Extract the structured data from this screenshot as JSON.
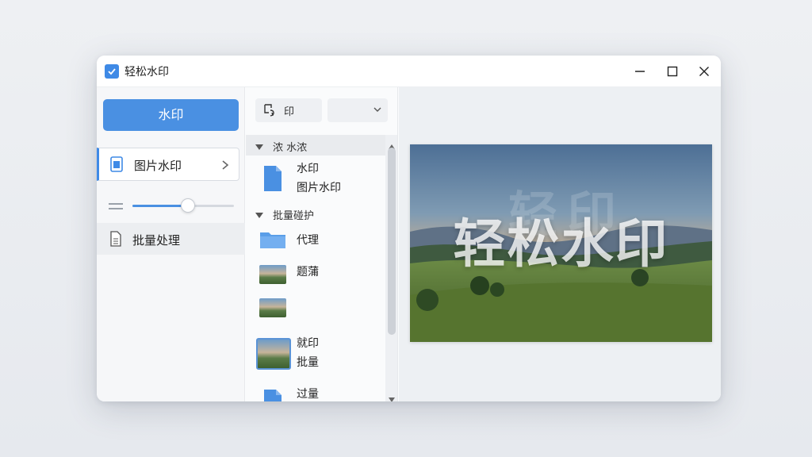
{
  "app": {
    "title": "轻松水印"
  },
  "window_controls": {
    "minimize": "minimize",
    "maximize": "maximize",
    "close": "close"
  },
  "sidebar": {
    "primary_button": "水印",
    "active_item": {
      "label": "图片水印",
      "icon": "image-file-icon"
    },
    "slider": {
      "value": 0.55
    },
    "item": {
      "label": "批量处理",
      "icon": "document-icon"
    }
  },
  "toolbar": {
    "tool_button_label": "印",
    "dropdown_value": ""
  },
  "tree": {
    "groups": [
      {
        "label": "浓 水浓",
        "files": [
          {
            "lines": [
              "水印",
              "图片水印"
            ],
            "icon": "file-icon"
          }
        ]
      },
      {
        "label": "批量碰护",
        "files": [
          {
            "name": "代理",
            "icon": "folder-icon"
          },
          {
            "name": "题蒲",
            "icon": "image-thumbnail"
          },
          {
            "name": "",
            "icon": "image-thumbnail"
          },
          {
            "lines": [
              "就印",
              "批量"
            ],
            "icon": "image-thumbnail-selected"
          },
          {
            "name": "过量",
            "icon": "file-icon"
          }
        ]
      }
    ]
  },
  "preview": {
    "watermark_text": "轻松水印",
    "ghost_text": "轻印"
  },
  "colors": {
    "accent": "#4a90e2",
    "window_bg": "#fbfcfd",
    "preview_bg": "#edf0f3"
  }
}
